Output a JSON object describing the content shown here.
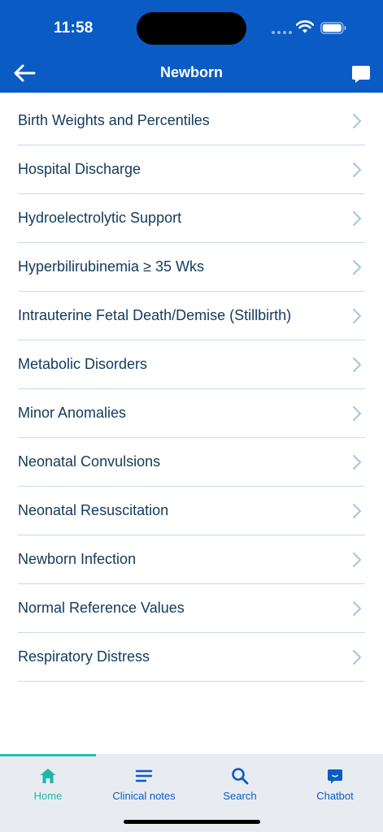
{
  "status": {
    "time": "11:58"
  },
  "header": {
    "title": "Newborn",
    "back_icon": "arrow-left-icon",
    "chat_icon": "chat-bubble-icon"
  },
  "items": [
    {
      "label": "Birth Weights and Percentiles"
    },
    {
      "label": "Hospital Discharge"
    },
    {
      "label": "Hydroelectrolytic Support"
    },
    {
      "label": "Hyperbilirubinemia ≥ 35 Wks"
    },
    {
      "label": "Intrauterine Fetal Death/Demise (Stillbirth)"
    },
    {
      "label": "Metabolic Disorders"
    },
    {
      "label": "Minor Anomalies"
    },
    {
      "label": "Neonatal Convulsions"
    },
    {
      "label": "Neonatal Resuscitation"
    },
    {
      "label": "Newborn Infection"
    },
    {
      "label": "Normal Reference Values"
    },
    {
      "label": "Respiratory Distress"
    }
  ],
  "tabs": [
    {
      "label": "Home",
      "icon": "home-icon",
      "active": true
    },
    {
      "label": "Clinical notes",
      "icon": "lines-icon",
      "active": false
    },
    {
      "label": "Search",
      "icon": "search-icon",
      "active": false
    },
    {
      "label": "Chatbot",
      "icon": "chatbot-icon",
      "active": false
    }
  ],
  "colors": {
    "header": "#0a5bc4",
    "active_tab": "#1fb5aa",
    "tab_text": "#0a5bc4",
    "item_text": "#123a5c",
    "divider": "#c9dbe8"
  }
}
